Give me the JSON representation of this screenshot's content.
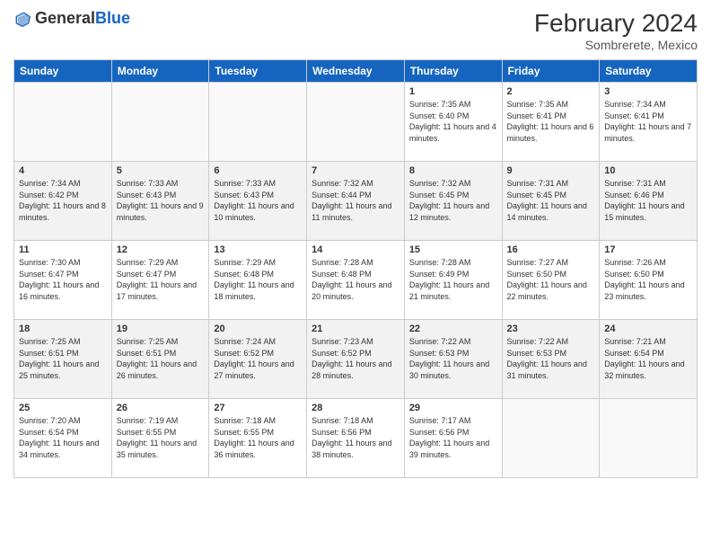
{
  "header": {
    "logo_general": "General",
    "logo_blue": "Blue",
    "title": "February 2024",
    "location": "Sombrerete, Mexico"
  },
  "days_of_week": [
    "Sunday",
    "Monday",
    "Tuesday",
    "Wednesday",
    "Thursday",
    "Friday",
    "Saturday"
  ],
  "weeks": [
    [
      {
        "day": "",
        "info": ""
      },
      {
        "day": "",
        "info": ""
      },
      {
        "day": "",
        "info": ""
      },
      {
        "day": "",
        "info": ""
      },
      {
        "day": "1",
        "info": "Sunrise: 7:35 AM\nSunset: 6:40 PM\nDaylight: 11 hours and 4 minutes."
      },
      {
        "day": "2",
        "info": "Sunrise: 7:35 AM\nSunset: 6:41 PM\nDaylight: 11 hours and 6 minutes."
      },
      {
        "day": "3",
        "info": "Sunrise: 7:34 AM\nSunset: 6:41 PM\nDaylight: 11 hours and 7 minutes."
      }
    ],
    [
      {
        "day": "4",
        "info": "Sunrise: 7:34 AM\nSunset: 6:42 PM\nDaylight: 11 hours and 8 minutes."
      },
      {
        "day": "5",
        "info": "Sunrise: 7:33 AM\nSunset: 6:43 PM\nDaylight: 11 hours and 9 minutes."
      },
      {
        "day": "6",
        "info": "Sunrise: 7:33 AM\nSunset: 6:43 PM\nDaylight: 11 hours and 10 minutes."
      },
      {
        "day": "7",
        "info": "Sunrise: 7:32 AM\nSunset: 6:44 PM\nDaylight: 11 hours and 11 minutes."
      },
      {
        "day": "8",
        "info": "Sunrise: 7:32 AM\nSunset: 6:45 PM\nDaylight: 11 hours and 12 minutes."
      },
      {
        "day": "9",
        "info": "Sunrise: 7:31 AM\nSunset: 6:45 PM\nDaylight: 11 hours and 14 minutes."
      },
      {
        "day": "10",
        "info": "Sunrise: 7:31 AM\nSunset: 6:46 PM\nDaylight: 11 hours and 15 minutes."
      }
    ],
    [
      {
        "day": "11",
        "info": "Sunrise: 7:30 AM\nSunset: 6:47 PM\nDaylight: 11 hours and 16 minutes."
      },
      {
        "day": "12",
        "info": "Sunrise: 7:29 AM\nSunset: 6:47 PM\nDaylight: 11 hours and 17 minutes."
      },
      {
        "day": "13",
        "info": "Sunrise: 7:29 AM\nSunset: 6:48 PM\nDaylight: 11 hours and 18 minutes."
      },
      {
        "day": "14",
        "info": "Sunrise: 7:28 AM\nSunset: 6:48 PM\nDaylight: 11 hours and 20 minutes."
      },
      {
        "day": "15",
        "info": "Sunrise: 7:28 AM\nSunset: 6:49 PM\nDaylight: 11 hours and 21 minutes."
      },
      {
        "day": "16",
        "info": "Sunrise: 7:27 AM\nSunset: 6:50 PM\nDaylight: 11 hours and 22 minutes."
      },
      {
        "day": "17",
        "info": "Sunrise: 7:26 AM\nSunset: 6:50 PM\nDaylight: 11 hours and 23 minutes."
      }
    ],
    [
      {
        "day": "18",
        "info": "Sunrise: 7:25 AM\nSunset: 6:51 PM\nDaylight: 11 hours and 25 minutes."
      },
      {
        "day": "19",
        "info": "Sunrise: 7:25 AM\nSunset: 6:51 PM\nDaylight: 11 hours and 26 minutes."
      },
      {
        "day": "20",
        "info": "Sunrise: 7:24 AM\nSunset: 6:52 PM\nDaylight: 11 hours and 27 minutes."
      },
      {
        "day": "21",
        "info": "Sunrise: 7:23 AM\nSunset: 6:52 PM\nDaylight: 11 hours and 28 minutes."
      },
      {
        "day": "22",
        "info": "Sunrise: 7:22 AM\nSunset: 6:53 PM\nDaylight: 11 hours and 30 minutes."
      },
      {
        "day": "23",
        "info": "Sunrise: 7:22 AM\nSunset: 6:53 PM\nDaylight: 11 hours and 31 minutes."
      },
      {
        "day": "24",
        "info": "Sunrise: 7:21 AM\nSunset: 6:54 PM\nDaylight: 11 hours and 32 minutes."
      }
    ],
    [
      {
        "day": "25",
        "info": "Sunrise: 7:20 AM\nSunset: 6:54 PM\nDaylight: 11 hours and 34 minutes."
      },
      {
        "day": "26",
        "info": "Sunrise: 7:19 AM\nSunset: 6:55 PM\nDaylight: 11 hours and 35 minutes."
      },
      {
        "day": "27",
        "info": "Sunrise: 7:18 AM\nSunset: 6:55 PM\nDaylight: 11 hours and 36 minutes."
      },
      {
        "day": "28",
        "info": "Sunrise: 7:18 AM\nSunset: 6:56 PM\nDaylight: 11 hours and 38 minutes."
      },
      {
        "day": "29",
        "info": "Sunrise: 7:17 AM\nSunset: 6:56 PM\nDaylight: 11 hours and 39 minutes."
      },
      {
        "day": "",
        "info": ""
      },
      {
        "day": "",
        "info": ""
      }
    ]
  ]
}
